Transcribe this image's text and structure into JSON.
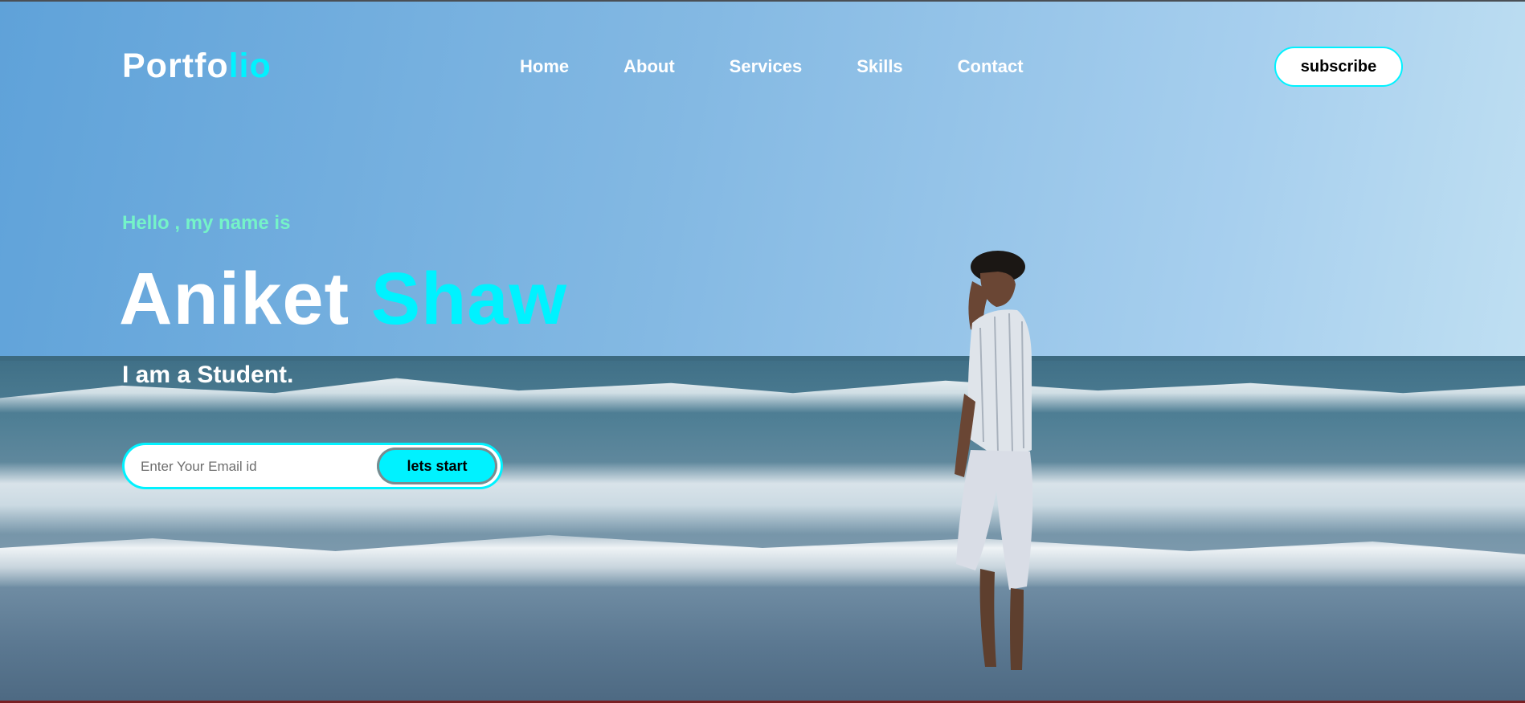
{
  "brand": {
    "logo_main": "Portfo",
    "logo_accent": "lio",
    "accent_color": "#00f2ff"
  },
  "nav": {
    "items": [
      "Home",
      "About",
      "Services",
      "Skills",
      "Contact"
    ]
  },
  "header": {
    "subscribe_label": "subscribe"
  },
  "hero": {
    "greeting": "Hello , my name is",
    "first_name": "Aniket",
    "last_name": "Shaw",
    "tagline": "I am a Student.",
    "email_placeholder": "Enter Your Email id",
    "cta_label": "lets start"
  }
}
